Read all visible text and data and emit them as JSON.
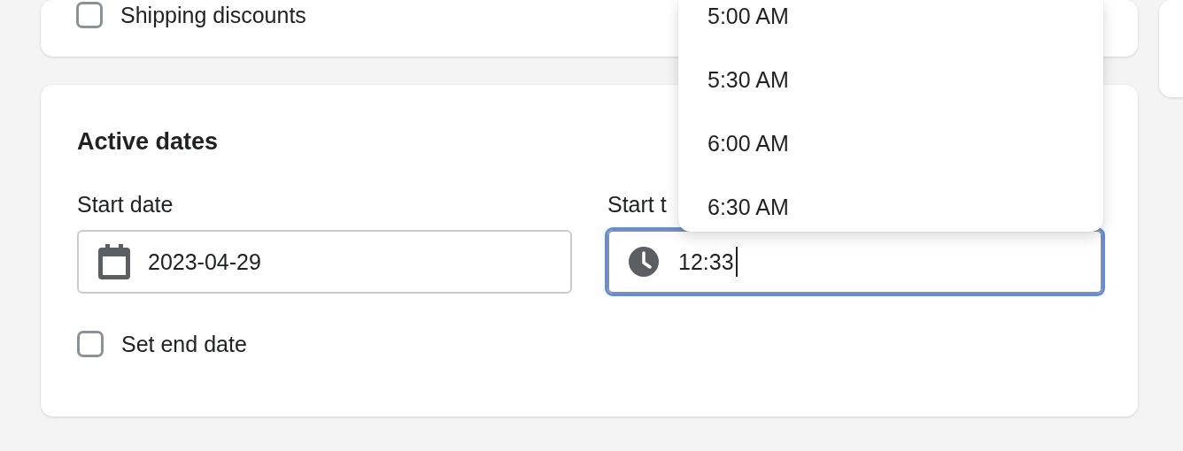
{
  "top_card": {
    "checkbox": {
      "label": "Shipping discounts",
      "checked": false
    }
  },
  "active_dates": {
    "title": "Active dates",
    "start_date": {
      "label": "Start date",
      "value": "2023-04-29"
    },
    "start_time": {
      "label": "Start t",
      "value": "12:33",
      "focused": true
    },
    "end_date_checkbox": {
      "label": "Set end date",
      "checked": false
    }
  },
  "time_dropdown": {
    "options": [
      {
        "label": "5:00 AM",
        "selected": false
      },
      {
        "label": "5:30 AM",
        "selected": false
      },
      {
        "label": "6:00 AM",
        "selected": false
      },
      {
        "label": "6:30 AM",
        "selected": false
      }
    ]
  }
}
